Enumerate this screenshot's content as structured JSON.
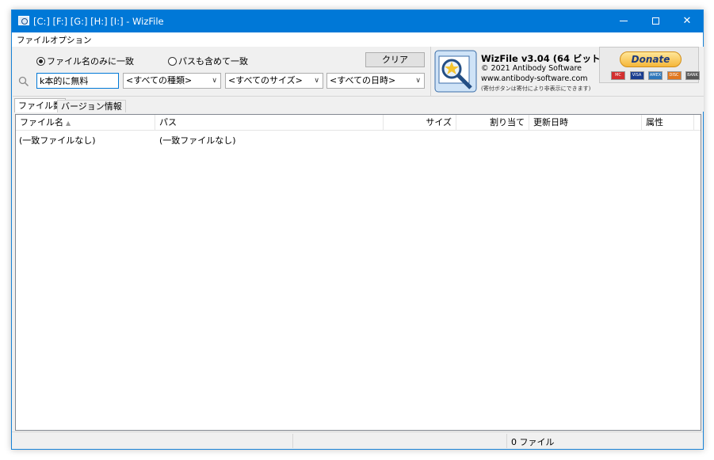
{
  "window": {
    "title": "[C:] [F:] [G:] [H:] [I:]  - WizFile"
  },
  "menu": [
    "ファイル",
    "オプション"
  ],
  "search": {
    "radio_filename_only": "ファイル名のみに一致",
    "radio_include_path": "パスも含めて一致",
    "radio_selected": "filename_only",
    "clear_button": "クリア",
    "query": "k本的に無料",
    "type_filter": "<すべての種類>",
    "size_filter": "<すべてのサイズ>",
    "date_filter": "<すべての日時>"
  },
  "about": {
    "title": "WizFile v3.04 (64 ビット)",
    "copyright": "© 2021 Antibody Software",
    "url": "www.antibody-software.com",
    "note": "(寄付ボタンは寄付により非表示にできます)",
    "donate_label": "Donate",
    "cards": [
      "MC",
      "VISA",
      "AMEX",
      "DISC",
      "BANK"
    ]
  },
  "tabs": [
    "ファイル数",
    "バージョン情報"
  ],
  "active_tab": 0,
  "columns": [
    "ファイル名",
    "パス",
    "サイズ",
    "割り当て",
    "更新日時",
    "属性"
  ],
  "rows": [
    {
      "name": "(一致ファイルなし)",
      "path": "(一致ファイルなし)"
    }
  ],
  "status": {
    "file_count": "0 ファイル"
  },
  "colors": {
    "titlebar": "#0078d7",
    "accent": "#0078d7",
    "donate": "#f5b63a"
  }
}
